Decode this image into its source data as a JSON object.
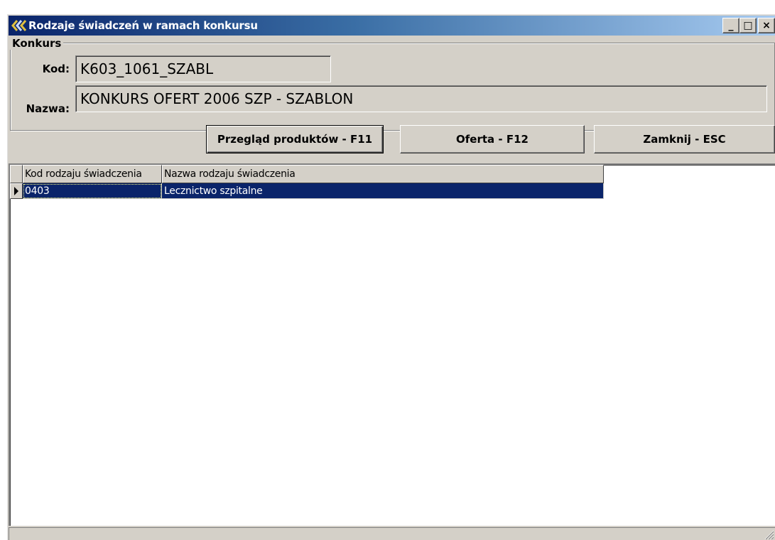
{
  "window": {
    "title": "Rodzaje świadczeń w ramach konkursu",
    "controls": {
      "minimize": "_",
      "maximize": "□",
      "close": "×"
    }
  },
  "konkurs": {
    "legend": "Konkurs",
    "kod_label": "Kod:",
    "kod_value": "K603_1061_SZABL",
    "nazwa_label": "Nazwa:",
    "nazwa_value": "KONKURS OFERT 2006 SZP - SZABLON"
  },
  "buttons": {
    "products": "Przegląd produktów - F11",
    "offer": "Oferta - F12",
    "close": "Zamknij - ESC"
  },
  "grid": {
    "columns": [
      "Kod rodzaju świadczenia",
      "Nazwa rodzaju świadczenia"
    ],
    "rows": [
      [
        "0403",
        "Lecznictwo szpitalne"
      ]
    ]
  },
  "colors": {
    "titlebar_start": "#0a246a",
    "titlebar_end": "#a6caf0",
    "selection": "#0a246a",
    "face": "#d4d0c8"
  }
}
